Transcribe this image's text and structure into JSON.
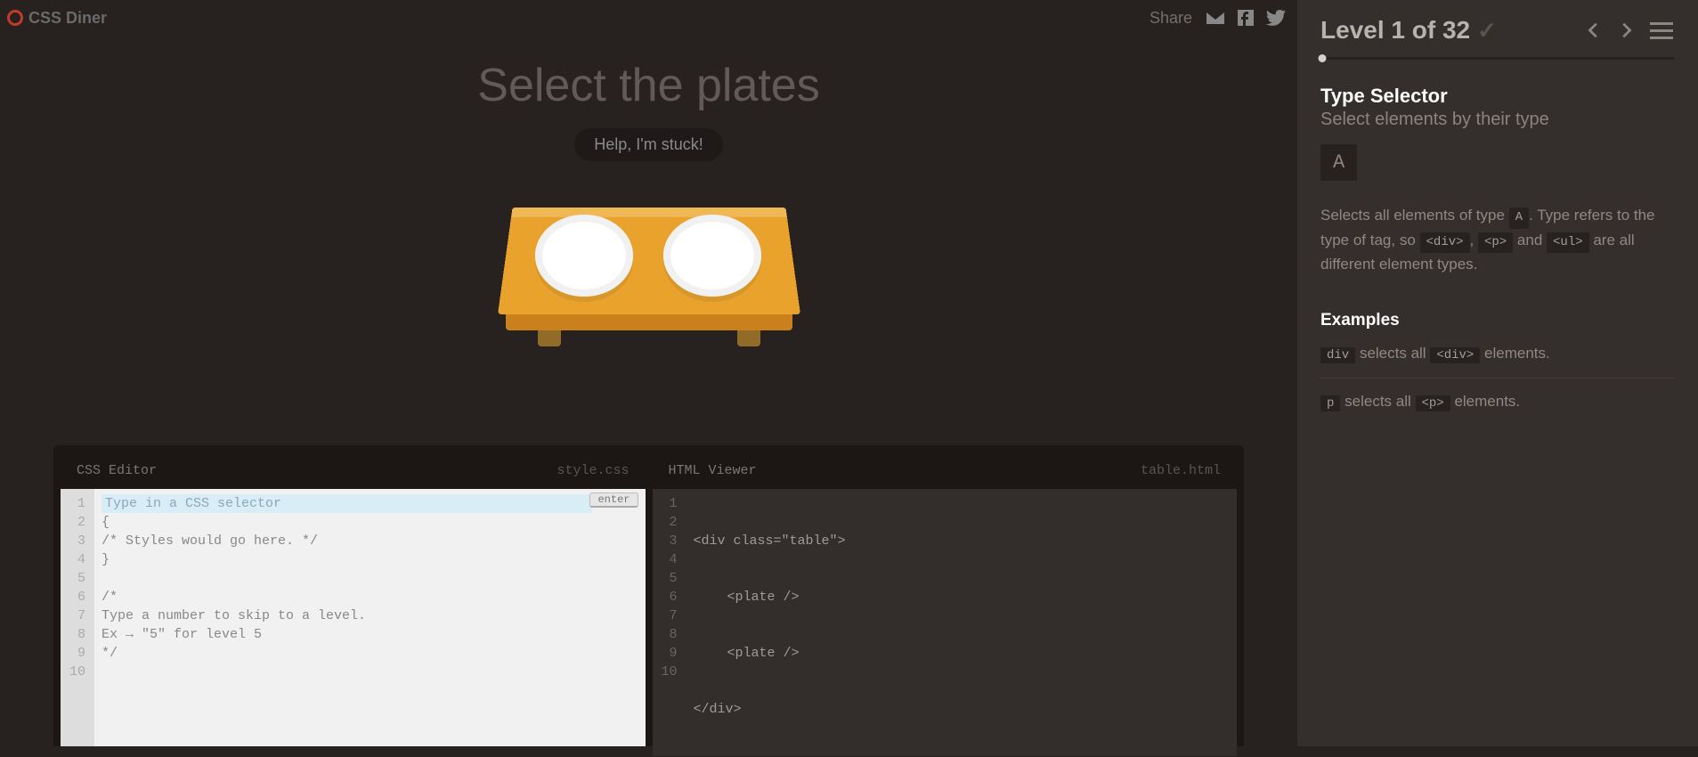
{
  "app": {
    "name": "CSS Diner"
  },
  "share": {
    "label": "Share"
  },
  "prompt": {
    "title": "Select the plates",
    "help_label": "Help, I'm stuck!"
  },
  "editors": {
    "css": {
      "title": "CSS Editor",
      "filename": "style.css",
      "input_placeholder": "Type in a CSS selector",
      "enter_label": "enter",
      "lines": [
        "{",
        "/* Styles would go here. */",
        "}",
        "",
        "/*",
        "Type a number to skip to a level.",
        "Ex → \"5\" for level 5",
        "*/"
      ],
      "line_numbers": [
        "1",
        "2",
        "3",
        "4",
        "5",
        "6",
        "7",
        "8",
        "9",
        "10"
      ]
    },
    "html": {
      "title": "HTML Viewer",
      "filename": "table.html",
      "lines": [
        "<div class=\"table\">",
        "  <plate />",
        "  <plate />",
        "</div>"
      ],
      "line_numbers": [
        "1",
        "2",
        "3",
        "4",
        "5",
        "6",
        "7",
        "8",
        "9",
        "10"
      ]
    }
  },
  "sidebar": {
    "level_text": "Level 1 of 32",
    "progress": {
      "current": 1,
      "total": 32
    },
    "selector_name": "Type Selector",
    "selector_sub": "Select elements by their type",
    "syntax": "A",
    "desc_1": "Selects all elements of type ",
    "desc_tag_A": "A",
    "desc_2": ". Type refers to the type of tag, so ",
    "desc_tag_div": "<div>",
    "desc_comma": ", ",
    "desc_tag_p": "<p>",
    "desc_and": " and ",
    "desc_tag_ul": "<ul>",
    "desc_3": " are all different element types.",
    "examples_heading": "Examples",
    "example1_code": "div",
    "example1_mid": " selects all ",
    "example1_tag": "<div>",
    "example1_end": " elements.",
    "example2_code": "p",
    "example2_mid": " selects all ",
    "example2_tag": "<p>",
    "example2_end": " elements."
  }
}
